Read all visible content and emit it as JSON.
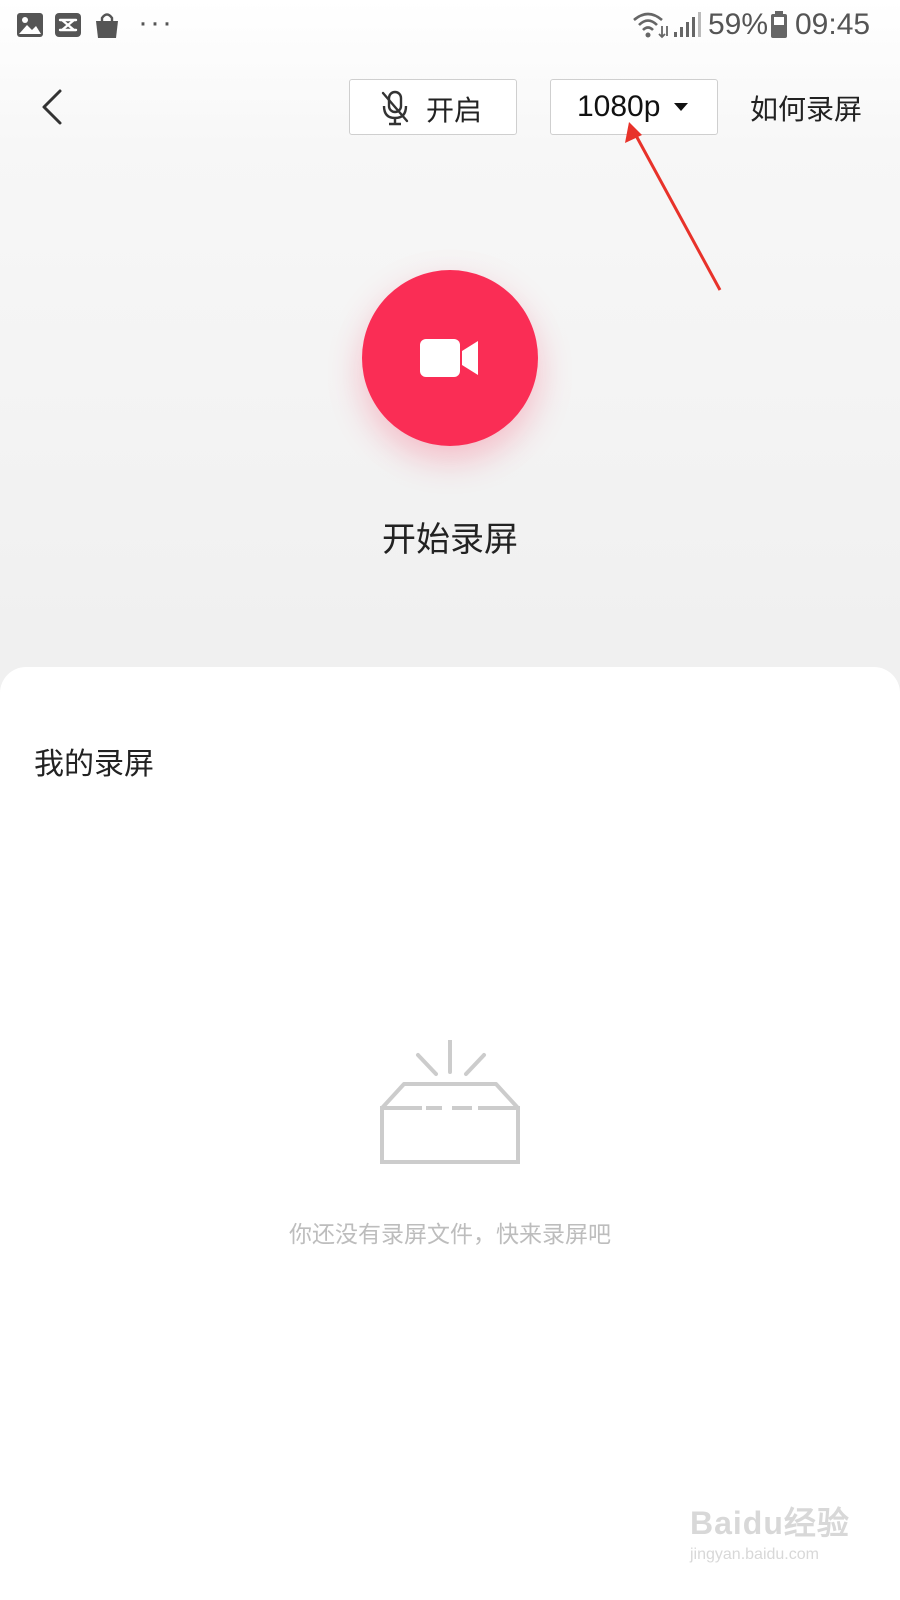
{
  "status_bar": {
    "icons": [
      "gallery-icon",
      "capcut-icon",
      "shopping-bag-icon",
      "more-dots-icon",
      "wifi-icon",
      "signal-icon",
      "battery-icon"
    ],
    "more": "···",
    "battery": "59%",
    "time": "09:45"
  },
  "toolbar": {
    "back_icon": "chevron-left-icon",
    "mic": {
      "icon": "mic-off-icon",
      "label": "开启"
    },
    "resolution": {
      "label": "1080p",
      "icon": "caret-down-icon"
    },
    "howto_label": "如何录屏"
  },
  "record": {
    "icon": "video-camera-icon",
    "label": "开始录屏",
    "color": "#fa2d55"
  },
  "my_recordings": {
    "title": "我的录屏",
    "empty_icon": "empty-box-icon",
    "empty_text": "你还没有录屏文件，快来录屏吧"
  },
  "annotation": {
    "color": "#e8322a"
  },
  "watermark": {
    "main": "Baidu经验",
    "sub": "jingyan.baidu.com"
  }
}
